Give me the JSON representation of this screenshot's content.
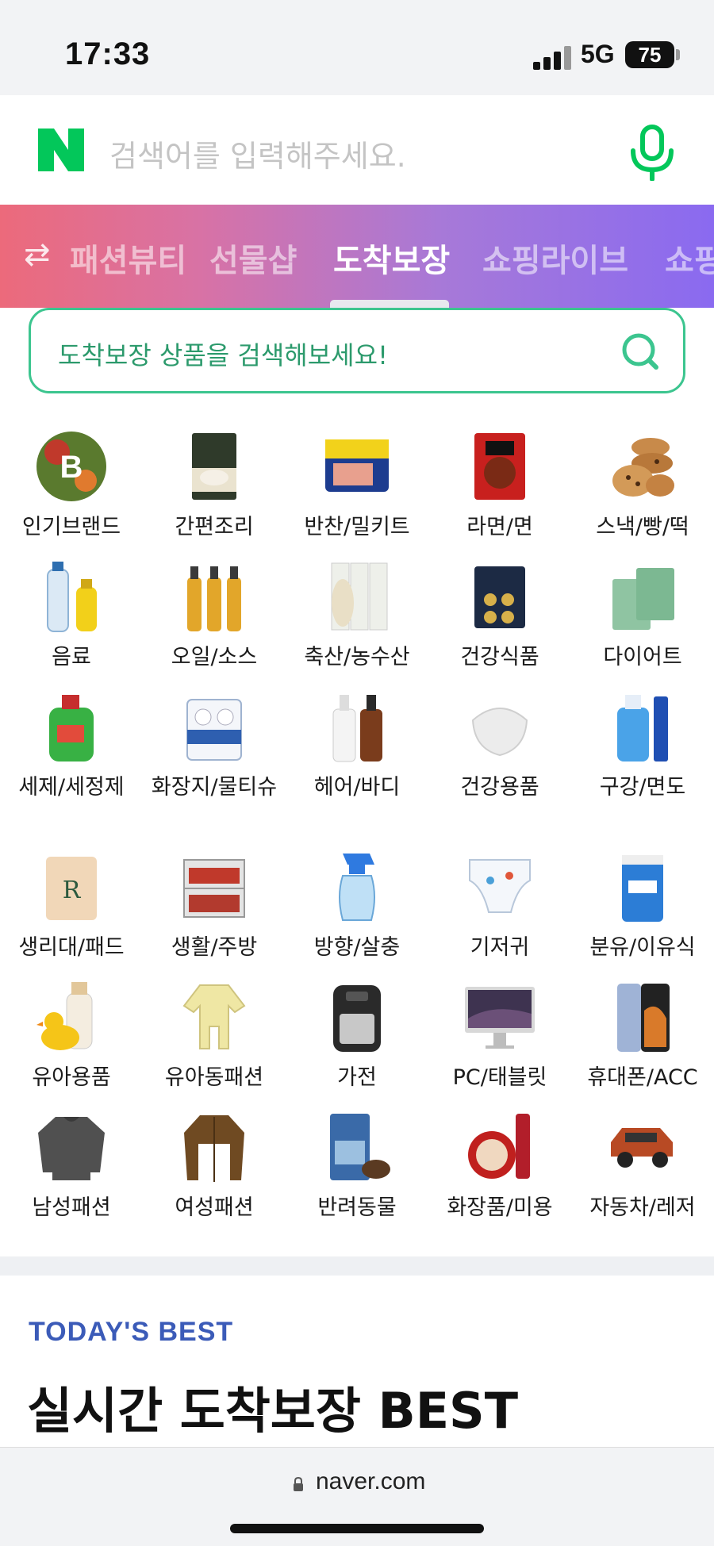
{
  "status_bar": {
    "time": "17:33",
    "network": "5G",
    "battery": "75"
  },
  "search": {
    "placeholder": "검색어를 입력해주세요."
  },
  "tabs": {
    "items": [
      {
        "label": "패션뷰티",
        "active": false
      },
      {
        "label": "선물샵",
        "active": false
      },
      {
        "label": "도착보장",
        "active": true
      },
      {
        "label": "쇼핑라이브",
        "active": false
      },
      {
        "label": "쇼핑",
        "active": false
      }
    ]
  },
  "arrival_search": {
    "placeholder": "도착보장 상품을 검색해보세요!"
  },
  "categories": [
    {
      "label": "인기브랜드",
      "icon": "brand-b-icon"
    },
    {
      "label": "간편조리",
      "icon": "dumpling-pack-icon"
    },
    {
      "label": "반찬/밀키트",
      "icon": "spam-can-icon"
    },
    {
      "label": "라면/면",
      "icon": "ramen-pack-icon"
    },
    {
      "label": "스낵/빵/떡",
      "icon": "cookies-icon"
    },
    {
      "label": "음료",
      "icon": "drink-bottles-icon"
    },
    {
      "label": "오일/소스",
      "icon": "oil-bottles-icon"
    },
    {
      "label": "축산/농수산",
      "icon": "chicken-breast-icon"
    },
    {
      "label": "건강식품",
      "icon": "supplement-box-icon"
    },
    {
      "label": "다이어트",
      "icon": "diet-box-icon"
    },
    {
      "label": "세제/세정제",
      "icon": "detergent-icon"
    },
    {
      "label": "화장지/물티슈",
      "icon": "tissue-roll-icon"
    },
    {
      "label": "헤어/바디",
      "icon": "shampoo-icon"
    },
    {
      "label": "건강용품",
      "icon": "face-mask-icon"
    },
    {
      "label": "구강/면도",
      "icon": "mouthwash-icon"
    },
    {
      "label": "생리대/패드",
      "icon": "pad-pack-icon"
    },
    {
      "label": "생활/주방",
      "icon": "storage-rack-icon"
    },
    {
      "label": "방향/살충",
      "icon": "spray-bottle-icon"
    },
    {
      "label": "기저귀",
      "icon": "diaper-icon"
    },
    {
      "label": "분유/이유식",
      "icon": "formula-can-icon"
    },
    {
      "label": "유아용품",
      "icon": "baby-bottle-duck-icon"
    },
    {
      "label": "유아동패션",
      "icon": "baby-romper-icon"
    },
    {
      "label": "가전",
      "icon": "air-fryer-icon"
    },
    {
      "label": "PC/태블릿",
      "icon": "imac-icon"
    },
    {
      "label": "휴대폰/ACC",
      "icon": "smartphone-icon"
    },
    {
      "label": "남성패션",
      "icon": "sweater-icon"
    },
    {
      "label": "여성패션",
      "icon": "jacket-icon"
    },
    {
      "label": "반려동물",
      "icon": "pet-food-icon"
    },
    {
      "label": "화장품/미용",
      "icon": "cosmetics-icon"
    },
    {
      "label": "자동차/레저",
      "icon": "suv-car-icon"
    }
  ],
  "best": {
    "kicker": "TODAY'S BEST",
    "title": "실시간 도착보장 BEST"
  },
  "browser": {
    "url": "naver.com"
  },
  "colors": {
    "naver_green": "#03c75a",
    "accent_green": "#3cc58f",
    "best_blue": "#3b5bb8"
  }
}
